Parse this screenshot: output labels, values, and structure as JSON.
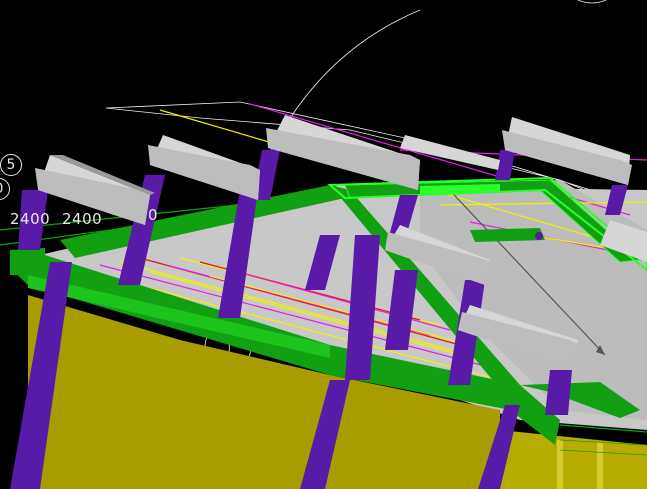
{
  "viewport": {
    "background": "#000000",
    "colors": {
      "column": "#5a1aa8",
      "beam": "#11a011",
      "wall": "#a89c00",
      "slab": "#c8c8c8",
      "precast_beam": "#d6d6d6",
      "rebar_yellow": "#f2f200",
      "rebar_magenta": "#e81ce8",
      "rebar_red": "#e01818",
      "wire": "#f0f0f0"
    }
  },
  "grid_bubbles": [
    {
      "label": "5"
    },
    {
      "label": "0"
    }
  ],
  "dimensions": [
    {
      "text": "2400"
    },
    {
      "text": "2400"
    },
    {
      "text": "0"
    }
  ]
}
